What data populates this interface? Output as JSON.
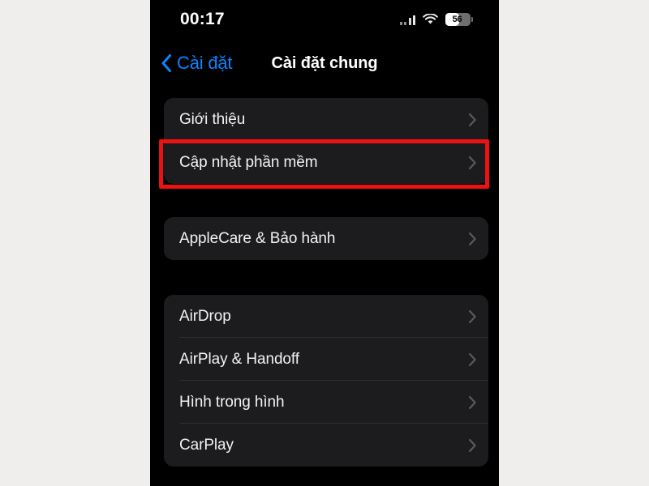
{
  "status_bar": {
    "time": "00:17",
    "cellular_icon": "cellular-signal-icon",
    "wifi_icon": "wifi-icon",
    "battery_icon": "battery-icon",
    "battery_level": "56",
    "battery_percent": 56
  },
  "nav": {
    "back_icon": "chevron-left-icon",
    "back_label": "Cài đặt",
    "title": "Cài đặt chung"
  },
  "colors": {
    "page_background": "#efeeec",
    "screen_background": "#000000",
    "card_background": "#1c1c1e",
    "accent_blue": "#0a84ff",
    "highlight_red": "#ee1111",
    "separator": "#2f2f31",
    "chevron_gray": "#5a5a5e",
    "label_white": "#f2f2f2"
  },
  "groups": [
    {
      "rows": [
        {
          "label": "Giới thiệu",
          "chevron": "chevron-right-icon",
          "highlighted": false
        },
        {
          "label": "Cập nhật phần mềm",
          "chevron": "chevron-right-icon",
          "highlighted": true
        }
      ]
    },
    {
      "rows": [
        {
          "label": "AppleCare & Bảo hành",
          "chevron": "chevron-right-icon",
          "highlighted": false
        }
      ]
    },
    {
      "rows": [
        {
          "label": "AirDrop",
          "chevron": "chevron-right-icon",
          "highlighted": false
        },
        {
          "label": "AirPlay & Handoff",
          "chevron": "chevron-right-icon",
          "highlighted": false
        },
        {
          "label": "Hình trong hình",
          "chevron": "chevron-right-icon",
          "highlighted": false
        },
        {
          "label": "CarPlay",
          "chevron": "chevron-right-icon",
          "highlighted": false
        }
      ]
    }
  ],
  "annotation": {
    "type": "red-rectangle-highlight",
    "target_label": "Cập nhật phần mềm"
  }
}
